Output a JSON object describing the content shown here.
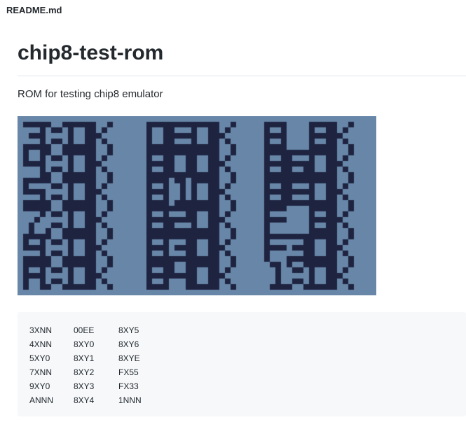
{
  "file_header": "README.md",
  "readme": {
    "title": "chip8-test-rom",
    "description": "ROM for testing chip8 emulator",
    "rom_screen": {
      "background": "#6887a8",
      "foreground": "#1e2340",
      "rows": [
        [
          "3X",
          "OK",
          "0E",
          "OK",
          "8 5",
          "OK"
        ],
        [
          "4X",
          "OK",
          "80",
          "OK",
          "86",
          "OK"
        ],
        [
          "5X",
          "OK",
          "81",
          "OK",
          "8E",
          "OK"
        ],
        [
          "7X",
          "OK",
          "82",
          "OK",
          "F 5",
          "OK"
        ],
        [
          "9X",
          "OK",
          "83",
          "OK",
          "F3",
          "OK"
        ],
        [
          "AX",
          "OK",
          "84",
          "OK",
          "1X",
          "OK"
        ]
      ]
    },
    "code_block": {
      "rows": [
        [
          "3XNN",
          "00EE",
          "8XY5"
        ],
        [
          "4XNN",
          "8XY0",
          "8XY6"
        ],
        [
          "5XY0",
          "8XY1",
          "8XYE"
        ],
        [
          "7XNN",
          "8XY2",
          "FX55"
        ],
        [
          "9XY0",
          "8XY3",
          "FX33"
        ],
        [
          "ANNN",
          "8XY4",
          "1NNN"
        ]
      ]
    }
  }
}
